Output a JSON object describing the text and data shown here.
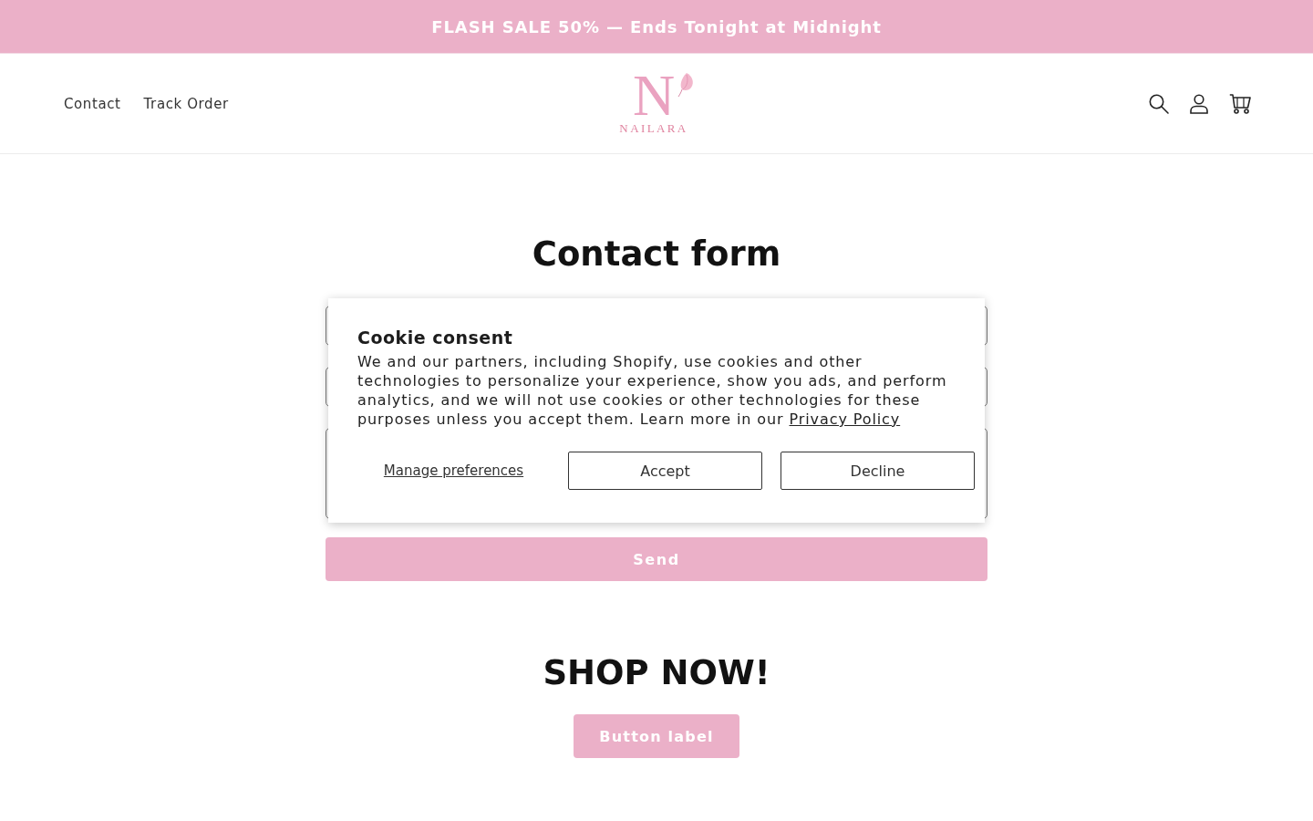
{
  "announcement": {
    "text": "FLASH SALE 50% — Ends Tonight at Midnight"
  },
  "header": {
    "nav": [
      {
        "label": "Contact"
      },
      {
        "label": "Track Order"
      }
    ],
    "logo": {
      "monogram": "N",
      "name": "NAILARA"
    }
  },
  "contact_form": {
    "title": "Contact form",
    "fields": [
      {
        "kind": "input"
      },
      {
        "kind": "input"
      },
      {
        "kind": "textarea"
      }
    ],
    "submit": "Send"
  },
  "cookie_consent": {
    "title": "Cookie consent",
    "body": "We and our partners, including Shopify, use cookies and other technologies to personalize your experience, show you ads, and perform analytics, and we will not use cookies or other technologies for these purposes unless you accept them. Learn more in our",
    "link": "Privacy Policy",
    "manage_link": "Manage preferences",
    "buttons": [
      "Accept",
      "Decline"
    ]
  },
  "shop_now": {
    "title": "SHOP NOW!",
    "button": "Button label"
  }
}
